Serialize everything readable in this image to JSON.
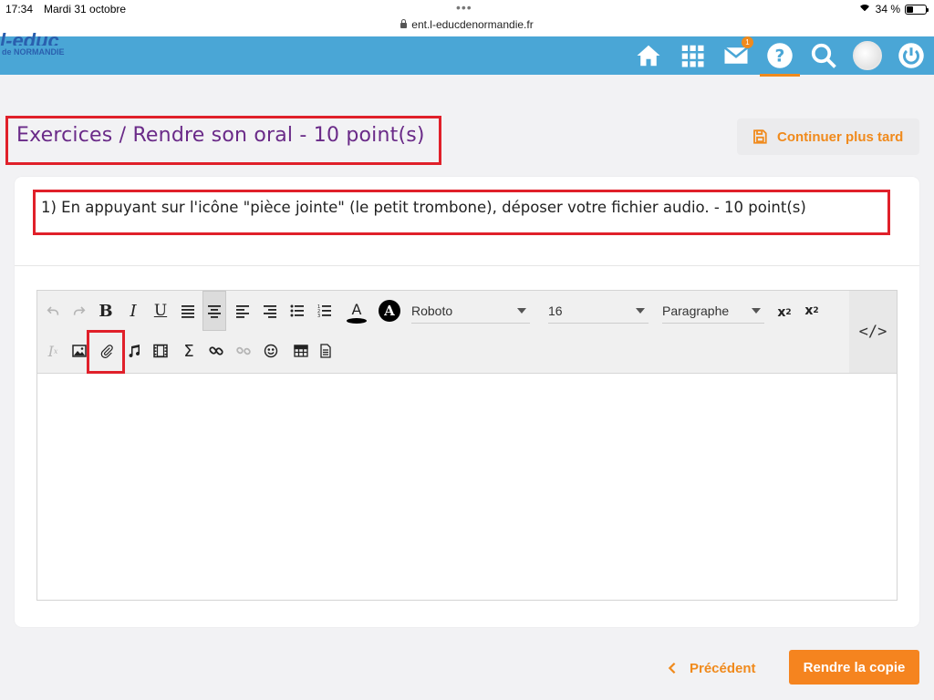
{
  "status_bar": {
    "time": "17:34",
    "date": "Mardi 31 octobre",
    "url": "ent.l-educdenormandie.fr",
    "battery": "34 %",
    "battery_level": 0.34
  },
  "header": {
    "logo_top": "l-educ",
    "logo_bottom": "de NORMANDIE",
    "mail_badge": "1",
    "icons": [
      "home-icon",
      "apps-grid-icon",
      "mail-icon",
      "help-icon",
      "search-icon",
      "avatar",
      "power-icon"
    ],
    "active_icon": "help-icon",
    "accent_color": "#4aa6d6",
    "highlight_color": "#f08a1c"
  },
  "page": {
    "title": "Exercices / Rendre son oral - 10 point(s)",
    "continue_later": "Continuer plus tard",
    "question": "1) En appuyant sur l'icône \"pièce jointe\" (le petit trombone), déposer votre fichier audio. - 10 point(s)"
  },
  "editor": {
    "font_family": "Roboto",
    "font_size": "16",
    "block_format": "Paragraphe",
    "code_view": "</>",
    "toolbar_row1": [
      "undo",
      "redo",
      "bold",
      "italic",
      "underline",
      "justify",
      "align-center",
      "align-left",
      "align-right",
      "bullet-list",
      "numbered-list",
      "text-color",
      "background-color",
      "subscript",
      "superscript"
    ],
    "toolbar_row2": [
      "clear-format",
      "image",
      "attachment",
      "audio",
      "video",
      "formula",
      "link",
      "unlink",
      "emoji",
      "table",
      "template"
    ],
    "text_content": ""
  },
  "footer": {
    "previous": "Précédent",
    "submit": "Rendre la copie"
  }
}
